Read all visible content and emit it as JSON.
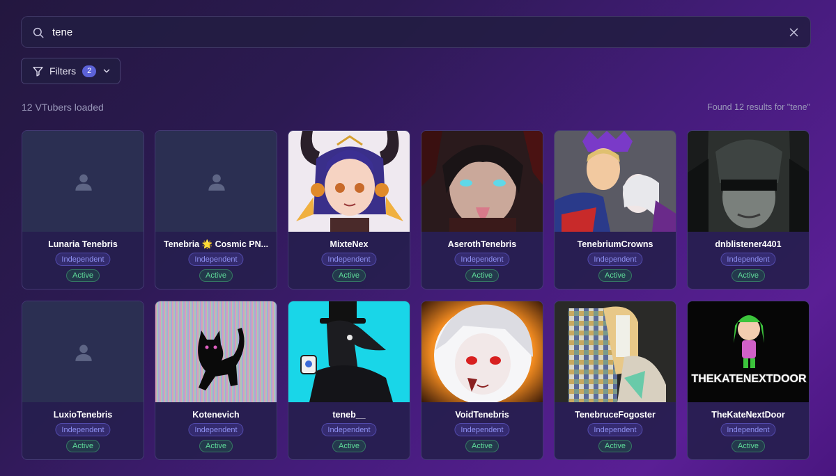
{
  "search": {
    "value": "tene",
    "placeholder": "Search VTubers..."
  },
  "filters": {
    "label": "Filters",
    "count": "2"
  },
  "summary": {
    "loaded": "12 VTubers loaded",
    "results": "Found 12 results for \"tene\""
  },
  "cards": [
    {
      "name": "Lunaria Tenebris",
      "affiliation": "Independent",
      "status": "Active"
    },
    {
      "name": "Tenebria 🌟 Cosmic PN...",
      "affiliation": "Independent",
      "status": "Active"
    },
    {
      "name": "MixteNex",
      "affiliation": "Independent",
      "status": "Active"
    },
    {
      "name": "AserothTenebris",
      "affiliation": "Independent",
      "status": "Active"
    },
    {
      "name": "TenebriumCrowns",
      "affiliation": "Independent",
      "status": "Active"
    },
    {
      "name": "dnblistener4401",
      "affiliation": "Independent",
      "status": "Active"
    },
    {
      "name": "LuxioTenebris",
      "affiliation": "Independent",
      "status": "Active"
    },
    {
      "name": "Kotenevich",
      "affiliation": "Independent",
      "status": "Active"
    },
    {
      "name": "teneb__",
      "affiliation": "Independent",
      "status": "Active"
    },
    {
      "name": "VoidTenebris",
      "affiliation": "Independent",
      "status": "Active"
    },
    {
      "name": "TenebruceFogoster",
      "affiliation": "Independent",
      "status": "Active"
    },
    {
      "name": "TheKateNextDoor",
      "affiliation": "Independent",
      "status": "Active"
    }
  ],
  "logo_text": "THEKATENEXTDOOR",
  "icons": {
    "search": "search-icon",
    "clear": "close-icon",
    "filter": "filter-icon",
    "chevron": "chevron-down-icon",
    "placeholder": "user-icon"
  }
}
